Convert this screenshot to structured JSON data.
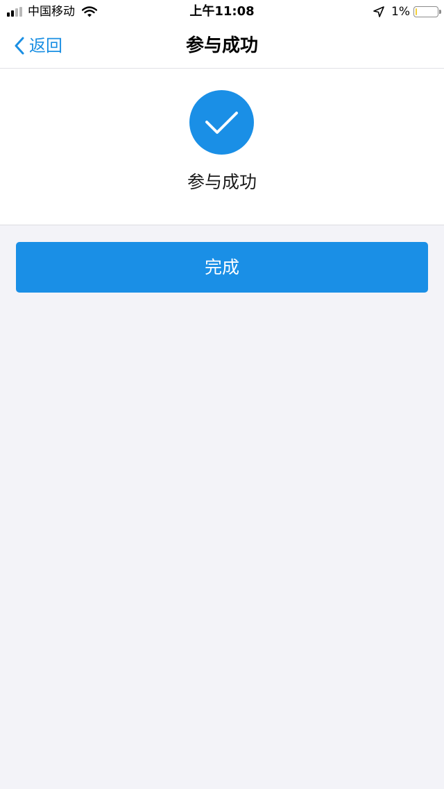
{
  "status_bar": {
    "carrier": "中国移动",
    "time": "上午11:08",
    "battery_percent": "1%",
    "battery_level": 0.01,
    "signal_bars_active": 2,
    "signal_bars_total": 4,
    "icons": [
      "signal-icon",
      "wifi-icon",
      "location-arrow-icon",
      "battery-icon"
    ]
  },
  "nav": {
    "back_label": "返回",
    "title": "参与成功",
    "back_icon": "chevron-left-icon"
  },
  "result": {
    "icon": "checkmark-circle-icon",
    "message": "参与成功"
  },
  "actions": {
    "done_label": "完成"
  },
  "colors": {
    "accent": "#1a8fe6",
    "background": "#f3f3f8",
    "card": "#ffffff",
    "battery_low": "#f4d034"
  }
}
